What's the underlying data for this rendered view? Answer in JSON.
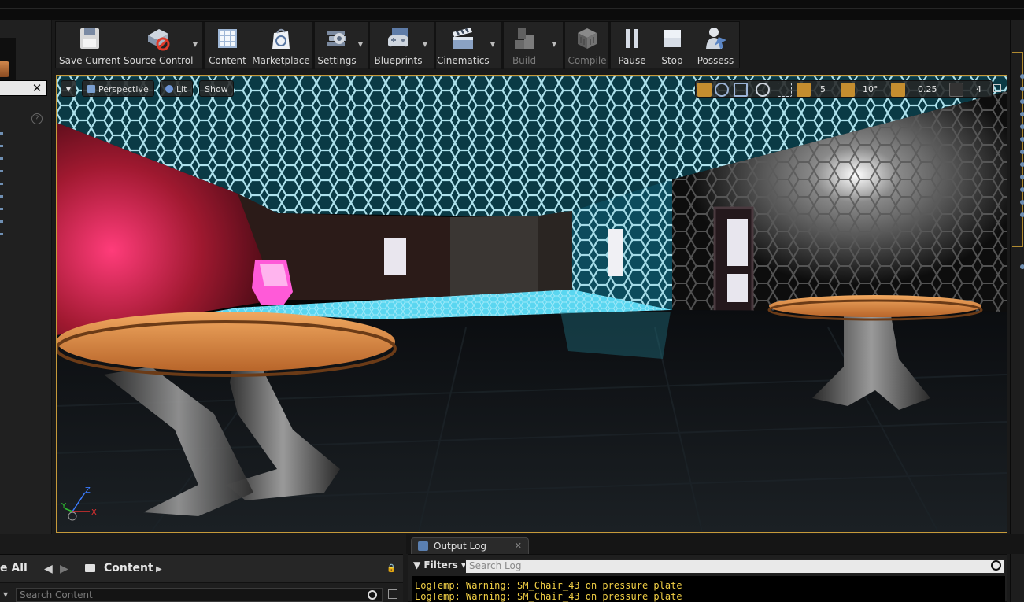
{
  "toolbar": {
    "buttons": [
      {
        "label": "Save Current",
        "icon": "floppy-disk-icon"
      },
      {
        "label": "Source Control",
        "icon": "source-control-icon"
      },
      {
        "label": "Content",
        "icon": "content-grid-icon"
      },
      {
        "label": "Marketplace",
        "icon": "marketplace-bag-icon"
      },
      {
        "label": "Settings",
        "icon": "gear-icon"
      },
      {
        "label": "Blueprints",
        "icon": "gamepad-icon"
      },
      {
        "label": "Cinematics",
        "icon": "clapperboard-icon"
      },
      {
        "label": "Build",
        "icon": "build-blocks-icon"
      },
      {
        "label": "Compile",
        "icon": "compile-cube-icon"
      },
      {
        "label": "Pause",
        "icon": "pause-icon"
      },
      {
        "label": "Stop",
        "icon": "stop-icon"
      },
      {
        "label": "Possess",
        "icon": "possess-person-icon"
      }
    ]
  },
  "viewport": {
    "view_mode": "Perspective",
    "lighting": "Lit",
    "show": "Show",
    "grid_snap": "5",
    "rotation_snap": "10°",
    "scale_snap": "0.25",
    "camera_speed": "4",
    "accent_color": "#c69a3a"
  },
  "content_browser": {
    "save_all": "e All",
    "path": "Content",
    "search_placeholder": "Search Content"
  },
  "output_log": {
    "tab_title": "Output Log",
    "filters": "Filters",
    "search_placeholder": "Search Log",
    "lines": [
      "LogTemp: Warning: SM_Chair_43 on pressure plate",
      "LogTemp: Warning: SM_Chair_43 on pressure plate"
    ],
    "line_color": "#f2d046"
  }
}
